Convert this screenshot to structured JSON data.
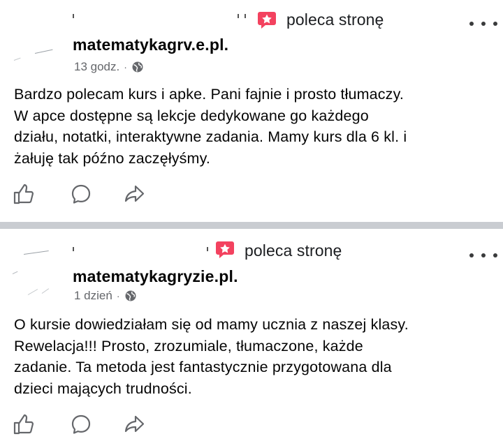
{
  "posts": [
    {
      "recommend_label": "poleca stronę",
      "page_name": "matematykagrv",
      "page_name_tail": ".e.pl.",
      "time": "13 godz.",
      "separator_dot": "·",
      "privacy_icon": "globe-icon",
      "body_lines": [
        "Bardzo polecam kurs i apke. Pani fajnie i prosto tłumaczy.",
        "W apce dostępne są lekcje dedykowane go każdego",
        "działu, notatki, interaktywne zadania. Mamy kurs dla 6 kl. i",
        "żałuję tak późno zaczęłyśmy."
      ]
    },
    {
      "recommend_label": "poleca stronę",
      "page_name": "matematykagryzie.pl",
      "page_name_tail": ".",
      "time": "1 dzień",
      "separator_dot": "·",
      "privacy_icon": "globe-icon",
      "body_lines": [
        "O kursie dowiedziałam się od mamy ucznia z naszej klasy.",
        "Rewelacja!!! Prosto, zrozumiale, tłumaczone, każde",
        "zadanie. Ta metoda jest fantastycznie przygotowana dla",
        "dzieci mających trudności."
      ]
    }
  ],
  "icons": {
    "recommend": "recommend-star-icon",
    "more": "more-options-icon",
    "like": "like-icon",
    "comment": "comment-icon",
    "share": "share-icon"
  },
  "colors": {
    "recommend_badge": "#f3425f",
    "separator": "#c9ccd1",
    "meta_text": "#65676b",
    "icon_stroke": "#65676b"
  }
}
